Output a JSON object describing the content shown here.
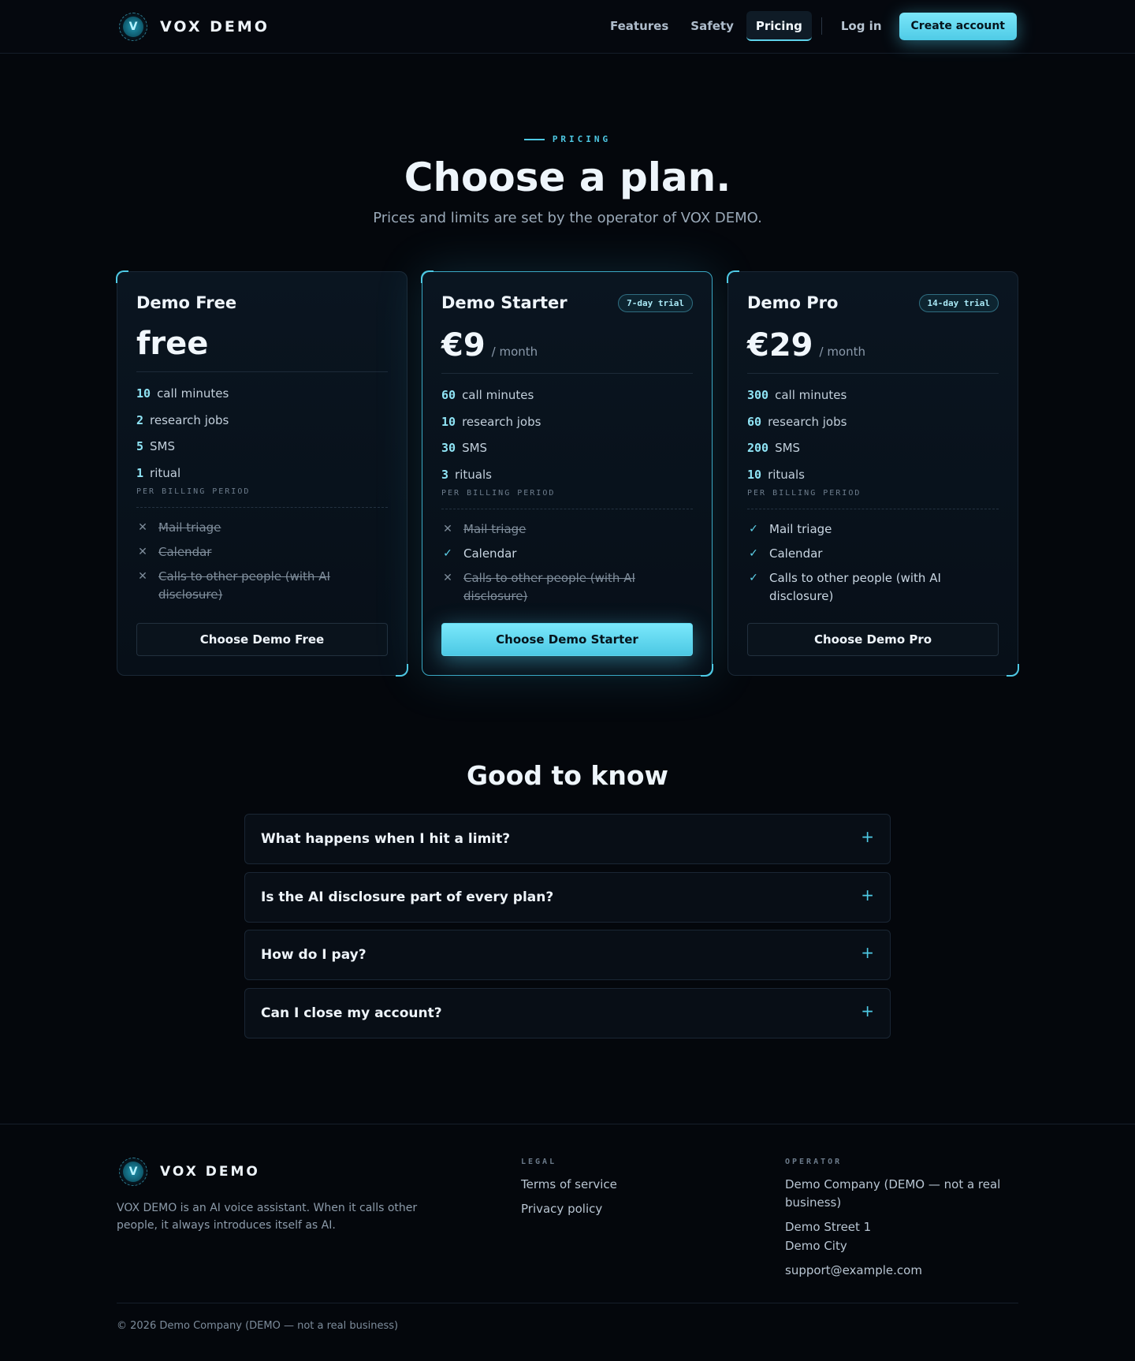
{
  "header": {
    "brand": "VOX DEMO",
    "nav": {
      "features": "Features",
      "safety": "Safety",
      "pricing": "Pricing",
      "login": "Log in",
      "cta": "Create account"
    }
  },
  "hero": {
    "eyebrow": "PRICING",
    "title": "Choose a plan.",
    "subtitle": "Prices and limits are set by the operator of VOX DEMO."
  },
  "plans": [
    {
      "name": "Demo Free",
      "badge": "",
      "price": "free",
      "period": "",
      "limits": [
        {
          "num": "10",
          "label": "call minutes"
        },
        {
          "num": "2",
          "label": "research jobs"
        },
        {
          "num": "5",
          "label": "SMS"
        },
        {
          "num": "1",
          "label": "ritual"
        }
      ],
      "billing": "PER BILLING PERIOD",
      "features": [
        {
          "label": "Mail triage",
          "included": false
        },
        {
          "label": "Calendar",
          "included": false
        },
        {
          "label": "Calls to other people (with AI disclosure)",
          "included": false
        }
      ],
      "button": "Choose Demo Free"
    },
    {
      "name": "Demo Starter",
      "badge": "7-day trial",
      "price": "€9",
      "period": "/ month",
      "limits": [
        {
          "num": "60",
          "label": "call minutes"
        },
        {
          "num": "10",
          "label": "research jobs"
        },
        {
          "num": "30",
          "label": "SMS"
        },
        {
          "num": "3",
          "label": "rituals"
        }
      ],
      "billing": "PER BILLING PERIOD",
      "features": [
        {
          "label": "Mail triage",
          "included": false
        },
        {
          "label": "Calendar",
          "included": true
        },
        {
          "label": "Calls to other people (with AI disclosure)",
          "included": false
        }
      ],
      "button": "Choose Demo Starter"
    },
    {
      "name": "Demo Pro",
      "badge": "14-day trial",
      "price": "€29",
      "period": "/ month",
      "limits": [
        {
          "num": "300",
          "label": "call minutes"
        },
        {
          "num": "60",
          "label": "research jobs"
        },
        {
          "num": "200",
          "label": "SMS"
        },
        {
          "num": "10",
          "label": "rituals"
        }
      ],
      "billing": "PER BILLING PERIOD",
      "features": [
        {
          "label": "Mail triage",
          "included": true
        },
        {
          "label": "Calendar",
          "included": true
        },
        {
          "label": "Calls to other people (with AI disclosure)",
          "included": true
        }
      ],
      "button": "Choose Demo Pro"
    }
  ],
  "faq": {
    "title": "Good to know",
    "items": [
      {
        "q": "What happens when I hit a limit?",
        "icon": "plus"
      },
      {
        "q": "Is the AI disclosure part of every plan?",
        "icon": "plus"
      },
      {
        "q": "How do I pay?",
        "icon": "plus"
      },
      {
        "q": "Can I close my account?",
        "icon": "plus"
      }
    ]
  },
  "footer": {
    "brand": "VOX DEMO",
    "description": "VOX DEMO is an AI voice assistant. When it calls other people, it always introduces itself as AI.",
    "legal": {
      "title": "LEGAL",
      "terms": "Terms of service",
      "privacy": "Privacy policy"
    },
    "operator": {
      "title": "OPERATOR",
      "company": "Demo Company (DEMO — not a real business)",
      "street": "Demo Street 1",
      "city": "Demo City",
      "email": "support@example.com"
    },
    "copyright": "© 2026 Demo Company (DEMO — not a real business)"
  },
  "colors": {
    "accent": "#4ec9e4",
    "background": "#04070c",
    "cta": "#7ae6fa"
  }
}
